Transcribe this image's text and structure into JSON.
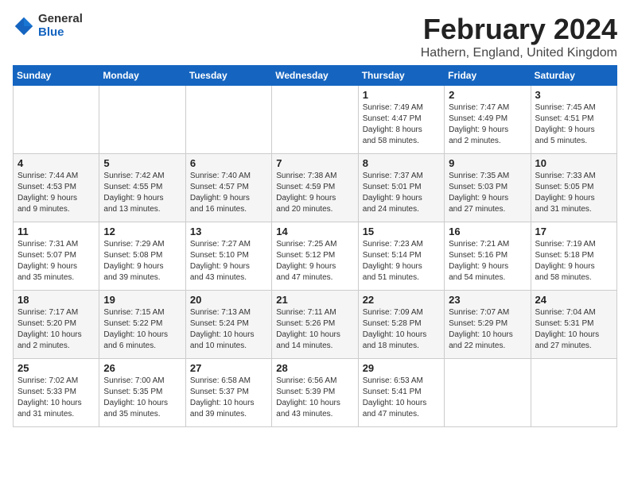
{
  "logo": {
    "general": "General",
    "blue": "Blue"
  },
  "title": {
    "month": "February 2024",
    "location": "Hathern, England, United Kingdom"
  },
  "weekdays": [
    "Sunday",
    "Monday",
    "Tuesday",
    "Wednesday",
    "Thursday",
    "Friday",
    "Saturday"
  ],
  "weeks": [
    [
      {
        "day": "",
        "info": ""
      },
      {
        "day": "",
        "info": ""
      },
      {
        "day": "",
        "info": ""
      },
      {
        "day": "",
        "info": ""
      },
      {
        "day": "1",
        "info": "Sunrise: 7:49 AM\nSunset: 4:47 PM\nDaylight: 8 hours\nand 58 minutes."
      },
      {
        "day": "2",
        "info": "Sunrise: 7:47 AM\nSunset: 4:49 PM\nDaylight: 9 hours\nand 2 minutes."
      },
      {
        "day": "3",
        "info": "Sunrise: 7:45 AM\nSunset: 4:51 PM\nDaylight: 9 hours\nand 5 minutes."
      }
    ],
    [
      {
        "day": "4",
        "info": "Sunrise: 7:44 AM\nSunset: 4:53 PM\nDaylight: 9 hours\nand 9 minutes."
      },
      {
        "day": "5",
        "info": "Sunrise: 7:42 AM\nSunset: 4:55 PM\nDaylight: 9 hours\nand 13 minutes."
      },
      {
        "day": "6",
        "info": "Sunrise: 7:40 AM\nSunset: 4:57 PM\nDaylight: 9 hours\nand 16 minutes."
      },
      {
        "day": "7",
        "info": "Sunrise: 7:38 AM\nSunset: 4:59 PM\nDaylight: 9 hours\nand 20 minutes."
      },
      {
        "day": "8",
        "info": "Sunrise: 7:37 AM\nSunset: 5:01 PM\nDaylight: 9 hours\nand 24 minutes."
      },
      {
        "day": "9",
        "info": "Sunrise: 7:35 AM\nSunset: 5:03 PM\nDaylight: 9 hours\nand 27 minutes."
      },
      {
        "day": "10",
        "info": "Sunrise: 7:33 AM\nSunset: 5:05 PM\nDaylight: 9 hours\nand 31 minutes."
      }
    ],
    [
      {
        "day": "11",
        "info": "Sunrise: 7:31 AM\nSunset: 5:07 PM\nDaylight: 9 hours\nand 35 minutes."
      },
      {
        "day": "12",
        "info": "Sunrise: 7:29 AM\nSunset: 5:08 PM\nDaylight: 9 hours\nand 39 minutes."
      },
      {
        "day": "13",
        "info": "Sunrise: 7:27 AM\nSunset: 5:10 PM\nDaylight: 9 hours\nand 43 minutes."
      },
      {
        "day": "14",
        "info": "Sunrise: 7:25 AM\nSunset: 5:12 PM\nDaylight: 9 hours\nand 47 minutes."
      },
      {
        "day": "15",
        "info": "Sunrise: 7:23 AM\nSunset: 5:14 PM\nDaylight: 9 hours\nand 51 minutes."
      },
      {
        "day": "16",
        "info": "Sunrise: 7:21 AM\nSunset: 5:16 PM\nDaylight: 9 hours\nand 54 minutes."
      },
      {
        "day": "17",
        "info": "Sunrise: 7:19 AM\nSunset: 5:18 PM\nDaylight: 9 hours\nand 58 minutes."
      }
    ],
    [
      {
        "day": "18",
        "info": "Sunrise: 7:17 AM\nSunset: 5:20 PM\nDaylight: 10 hours\nand 2 minutes."
      },
      {
        "day": "19",
        "info": "Sunrise: 7:15 AM\nSunset: 5:22 PM\nDaylight: 10 hours\nand 6 minutes."
      },
      {
        "day": "20",
        "info": "Sunrise: 7:13 AM\nSunset: 5:24 PM\nDaylight: 10 hours\nand 10 minutes."
      },
      {
        "day": "21",
        "info": "Sunrise: 7:11 AM\nSunset: 5:26 PM\nDaylight: 10 hours\nand 14 minutes."
      },
      {
        "day": "22",
        "info": "Sunrise: 7:09 AM\nSunset: 5:28 PM\nDaylight: 10 hours\nand 18 minutes."
      },
      {
        "day": "23",
        "info": "Sunrise: 7:07 AM\nSunset: 5:29 PM\nDaylight: 10 hours\nand 22 minutes."
      },
      {
        "day": "24",
        "info": "Sunrise: 7:04 AM\nSunset: 5:31 PM\nDaylight: 10 hours\nand 27 minutes."
      }
    ],
    [
      {
        "day": "25",
        "info": "Sunrise: 7:02 AM\nSunset: 5:33 PM\nDaylight: 10 hours\nand 31 minutes."
      },
      {
        "day": "26",
        "info": "Sunrise: 7:00 AM\nSunset: 5:35 PM\nDaylight: 10 hours\nand 35 minutes."
      },
      {
        "day": "27",
        "info": "Sunrise: 6:58 AM\nSunset: 5:37 PM\nDaylight: 10 hours\nand 39 minutes."
      },
      {
        "day": "28",
        "info": "Sunrise: 6:56 AM\nSunset: 5:39 PM\nDaylight: 10 hours\nand 43 minutes."
      },
      {
        "day": "29",
        "info": "Sunrise: 6:53 AM\nSunset: 5:41 PM\nDaylight: 10 hours\nand 47 minutes."
      },
      {
        "day": "",
        "info": ""
      },
      {
        "day": "",
        "info": ""
      }
    ]
  ]
}
